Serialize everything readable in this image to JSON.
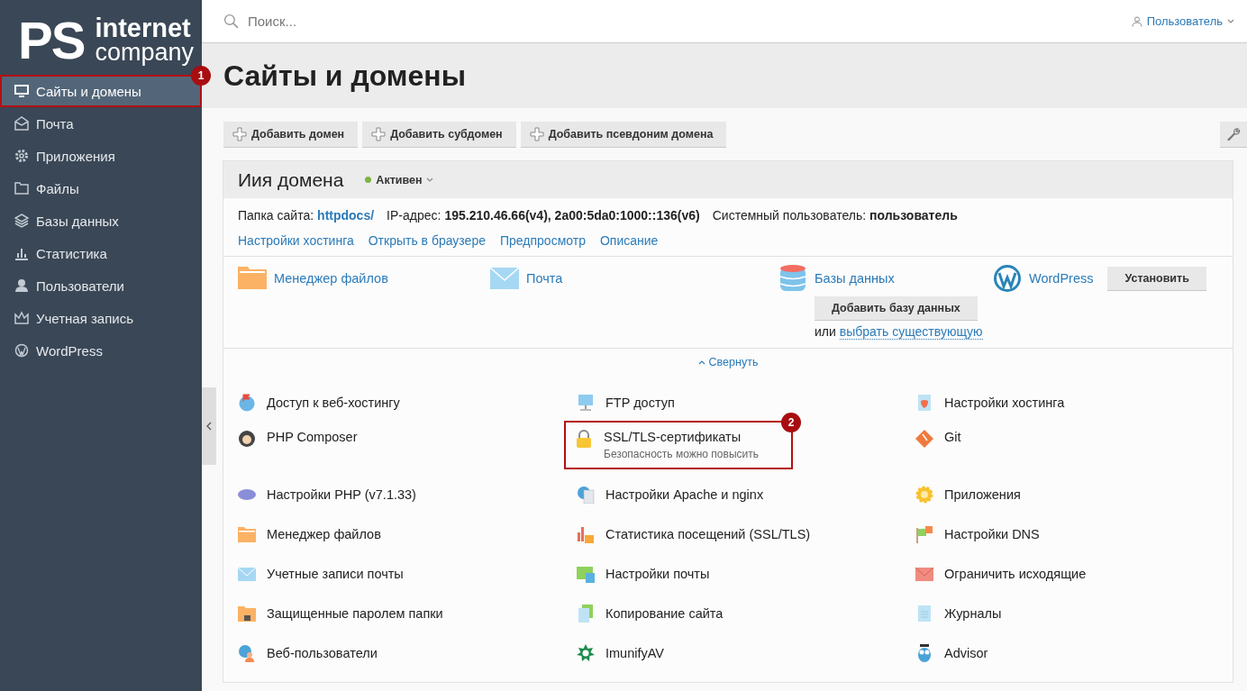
{
  "logo": {
    "initials": "PS",
    "line1": "internet",
    "line2": "company"
  },
  "callouts": [
    "1",
    "2"
  ],
  "sidebar": {
    "items": [
      {
        "label": "Сайты и домены",
        "selected": true,
        "framed": true
      },
      {
        "label": "Почта",
        "selected": false,
        "framed": false
      },
      {
        "label": "Приложения",
        "selected": false,
        "framed": false
      },
      {
        "label": "Файлы",
        "selected": false,
        "framed": false
      },
      {
        "label": "Базы данных",
        "selected": false,
        "framed": false
      },
      {
        "label": "Статистика",
        "selected": false,
        "framed": false
      },
      {
        "label": "Пользователи",
        "selected": false,
        "framed": false
      },
      {
        "label": "Учетная запись",
        "selected": false,
        "framed": false
      },
      {
        "label": "WordPress",
        "selected": false,
        "framed": false
      }
    ]
  },
  "search": {
    "placeholder": "Поиск..."
  },
  "user_menu": {
    "label": "Пользователь"
  },
  "page_title": "Сайты и домены",
  "toolbar": {
    "buttons": [
      "Добавить домен",
      "Добавить субдомен",
      "Добавить псевдоним домена"
    ]
  },
  "domain": {
    "name": "Иия домена",
    "status": "Активен",
    "info": [
      {
        "label": "Папка сайта:",
        "value": "httpdocs/",
        "kind": "link"
      },
      {
        "label": "IP-адрес:",
        "value": "195.210.46.66(v4), 2a00:5da0:1000::136(v6)",
        "kind": "bold"
      },
      {
        "label": "Системный пользователь:",
        "value": "пользователь",
        "kind": "bold"
      }
    ],
    "links": [
      "Настройки хостинга",
      "Открыть в браузере",
      "Предпросмотр",
      "Описание"
    ],
    "quick": [
      {
        "label": "Менеджер файлов",
        "kind": "plain"
      },
      {
        "label": "Почта",
        "kind": "plain"
      },
      {
        "label": "Базы данных",
        "kind": "actions",
        "button": "Добавить базу данных",
        "or": "или",
        "or_link": "выбрать существующую"
      },
      {
        "label": "WordPress",
        "kind": "button",
        "button": "Установить"
      }
    ],
    "collapse": "Свернуть",
    "tools": [
      {
        "label": "Доступ к веб-хостингу",
        "framed": false
      },
      {
        "label": "FTP доступ",
        "framed": false
      },
      {
        "label": "Настройки хостинга",
        "framed": false
      },
      {
        "label": "PHP Composer",
        "framed": false
      },
      {
        "label": "SSL/TLS-сертификаты",
        "subtitle": "Безопасность можно повысить",
        "framed": true
      },
      {
        "label": "Git",
        "framed": false
      },
      {
        "label": "Настройки PHP (v7.1.33)",
        "framed": false
      },
      {
        "label": "Настройки Apache и nginx",
        "framed": false
      },
      {
        "label": "Приложения",
        "framed": false
      },
      {
        "label": "Менеджер файлов",
        "framed": false
      },
      {
        "label": "Статистика посещений (SSL/TLS)",
        "framed": false
      },
      {
        "label": "Настройки DNS",
        "framed": false
      },
      {
        "label": "Учетные записи почты",
        "framed": false
      },
      {
        "label": "Настройки почты",
        "framed": false
      },
      {
        "label": "Ограничить исходящие",
        "framed": false
      },
      {
        "label": "Защищенные паролем папки",
        "framed": false
      },
      {
        "label": "Копирование сайта",
        "framed": false
      },
      {
        "label": "Журналы",
        "framed": false
      },
      {
        "label": "Веб-пользователи",
        "framed": false
      },
      {
        "label": "ImunifyAV",
        "framed": false
      },
      {
        "label": "Advisor",
        "framed": false
      }
    ]
  }
}
